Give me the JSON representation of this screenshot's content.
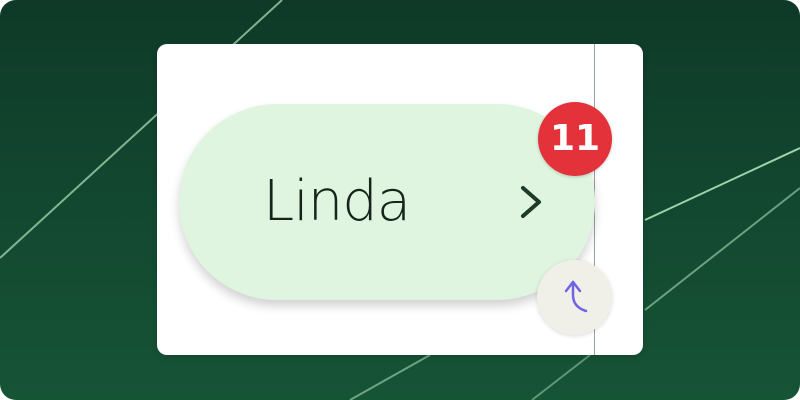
{
  "contact_card": {
    "name": "Linda",
    "unread_count": "11"
  },
  "icons": {
    "chevron": "chevron-right-icon",
    "action": "up-arrow-icon"
  },
  "colors": {
    "background": "#12462f",
    "pill_fill": "#dff5df",
    "badge": "#e3323a",
    "fab_icon": "#6f63e6",
    "bg_line": "#9fd6ad"
  }
}
